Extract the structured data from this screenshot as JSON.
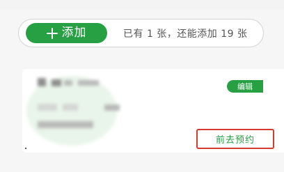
{
  "add_bar": {
    "add_button_label": "添加",
    "status_text": "已有 1 张，还能添加 19 张"
  },
  "card": {
    "edit_label": "编辑",
    "reserve_label": "前去预约"
  },
  "colors": {
    "brand_green": "#27a043",
    "highlight_red": "#d63a2f"
  },
  "icons": {
    "add": "plus-icon"
  }
}
